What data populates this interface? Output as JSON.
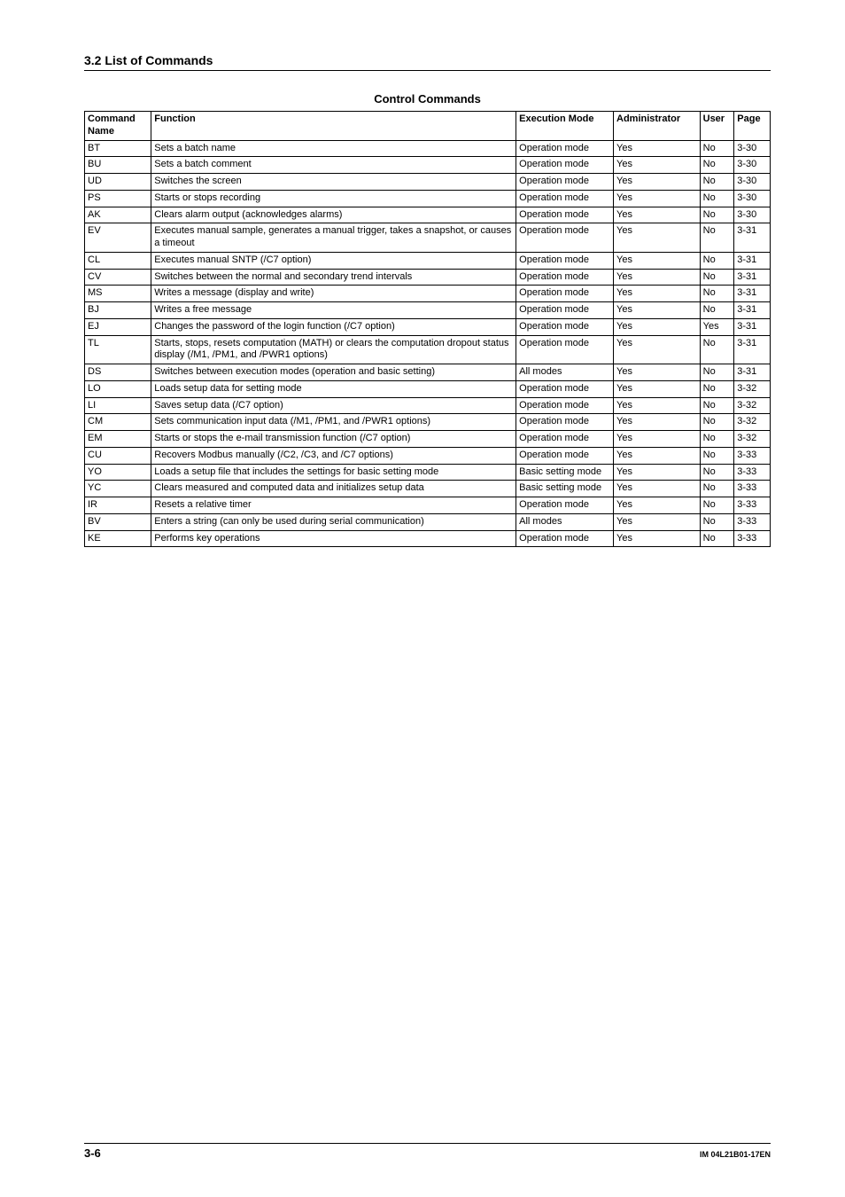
{
  "section_heading": "3.2  List of Commands",
  "table_title": "Control Commands",
  "headers": {
    "name": "Command Name",
    "func": "Function",
    "exec": "Execution Mode",
    "admin": "Administrator",
    "user": "User",
    "page": "Page"
  },
  "rows": [
    {
      "name": "BT",
      "func": "Sets a batch name",
      "exec": "Operation mode",
      "admin": "Yes",
      "user": "No",
      "page": "3-30"
    },
    {
      "name": "BU",
      "func": "Sets a batch comment",
      "exec": "Operation mode",
      "admin": "Yes",
      "user": "No",
      "page": "3-30"
    },
    {
      "name": "UD",
      "func": "Switches the screen",
      "exec": "Operation mode",
      "admin": "Yes",
      "user": "No",
      "page": "3-30"
    },
    {
      "name": "PS",
      "func": "Starts or stops recording",
      "exec": "Operation mode",
      "admin": "Yes",
      "user": "No",
      "page": "3-30"
    },
    {
      "name": "AK",
      "func": "Clears alarm output (acknowledges alarms)",
      "exec": "Operation mode",
      "admin": "Yes",
      "user": "No",
      "page": "3-30"
    },
    {
      "name": "EV",
      "func": "Executes manual sample, generates a manual trigger, takes a snapshot, or causes a timeout",
      "exec": "Operation mode",
      "admin": "Yes",
      "user": "No",
      "page": "3-31"
    },
    {
      "name": "CL",
      "func": "Executes manual SNTP (/C7 option)",
      "exec": "Operation mode",
      "admin": "Yes",
      "user": "No",
      "page": "3-31"
    },
    {
      "name": "CV",
      "func": "Switches between the normal and secondary trend intervals",
      "exec": "Operation mode",
      "admin": "Yes",
      "user": "No",
      "page": "3-31"
    },
    {
      "name": "MS",
      "func": "Writes a message (display and write)",
      "exec": "Operation mode",
      "admin": "Yes",
      "user": "No",
      "page": "3-31"
    },
    {
      "name": "BJ",
      "func": "Writes a free message",
      "exec": "Operation mode",
      "admin": "Yes",
      "user": "No",
      "page": "3-31"
    },
    {
      "name": "EJ",
      "func": "Changes the password of the login function (/C7 option)",
      "exec": "Operation mode",
      "admin": "Yes",
      "user": "Yes",
      "page": "3-31"
    },
    {
      "name": "TL",
      "func": "Starts, stops, resets computation (MATH) or clears the computation dropout status display (/M1, /PM1, and /PWR1 options)",
      "exec": "Operation mode",
      "admin": "Yes",
      "user": "No",
      "page": "3-31"
    },
    {
      "name": "DS",
      "func": "Switches between execution modes (operation and basic setting)",
      "exec": "All modes",
      "admin": "Yes",
      "user": "No",
      "page": "3-31"
    },
    {
      "name": "LO",
      "func": "Loads setup data for setting mode",
      "exec": "Operation mode",
      "admin": "Yes",
      "user": "No",
      "page": "3-32"
    },
    {
      "name": "LI",
      "func": "Saves setup data (/C7 option)",
      "exec": "Operation mode",
      "admin": "Yes",
      "user": "No",
      "page": "3-32"
    },
    {
      "name": "CM",
      "func": "Sets communication input data (/M1, /PM1, and /PWR1 options)",
      "exec": "Operation mode",
      "admin": "Yes",
      "user": "No",
      "page": "3-32"
    },
    {
      "name": "EM",
      "func": "Starts or stops the e-mail transmission function (/C7 option)",
      "exec": "Operation mode",
      "admin": "Yes",
      "user": "No",
      "page": "3-32"
    },
    {
      "name": "CU",
      "func": "Recovers Modbus manually (/C2, /C3, and /C7 options)",
      "exec": "Operation mode",
      "admin": "Yes",
      "user": "No",
      "page": "3-33"
    },
    {
      "name": "YO",
      "func": "Loads a setup file that includes the settings for basic setting mode",
      "exec": "Basic setting mode",
      "admin": "Yes",
      "user": "No",
      "page": "3-33"
    },
    {
      "name": "YC",
      "func": "Clears measured and computed data and initializes setup data",
      "exec": "Basic setting mode",
      "admin": "Yes",
      "user": "No",
      "page": "3-33"
    },
    {
      "name": "IR",
      "func": "Resets a relative timer",
      "exec": "Operation mode",
      "admin": "Yes",
      "user": "No",
      "page": "3-33"
    },
    {
      "name": "BV",
      "func": "Enters a string (can only be used during serial communication)",
      "exec": "All modes",
      "admin": "Yes",
      "user": "No",
      "page": "3-33"
    },
    {
      "name": "KE",
      "func": "Performs key operations",
      "exec": "Operation mode",
      "admin": "Yes",
      "user": "No",
      "page": "3-33"
    }
  ],
  "footer": {
    "page_number": "3-6",
    "doc_id": "IM 04L21B01-17EN"
  }
}
